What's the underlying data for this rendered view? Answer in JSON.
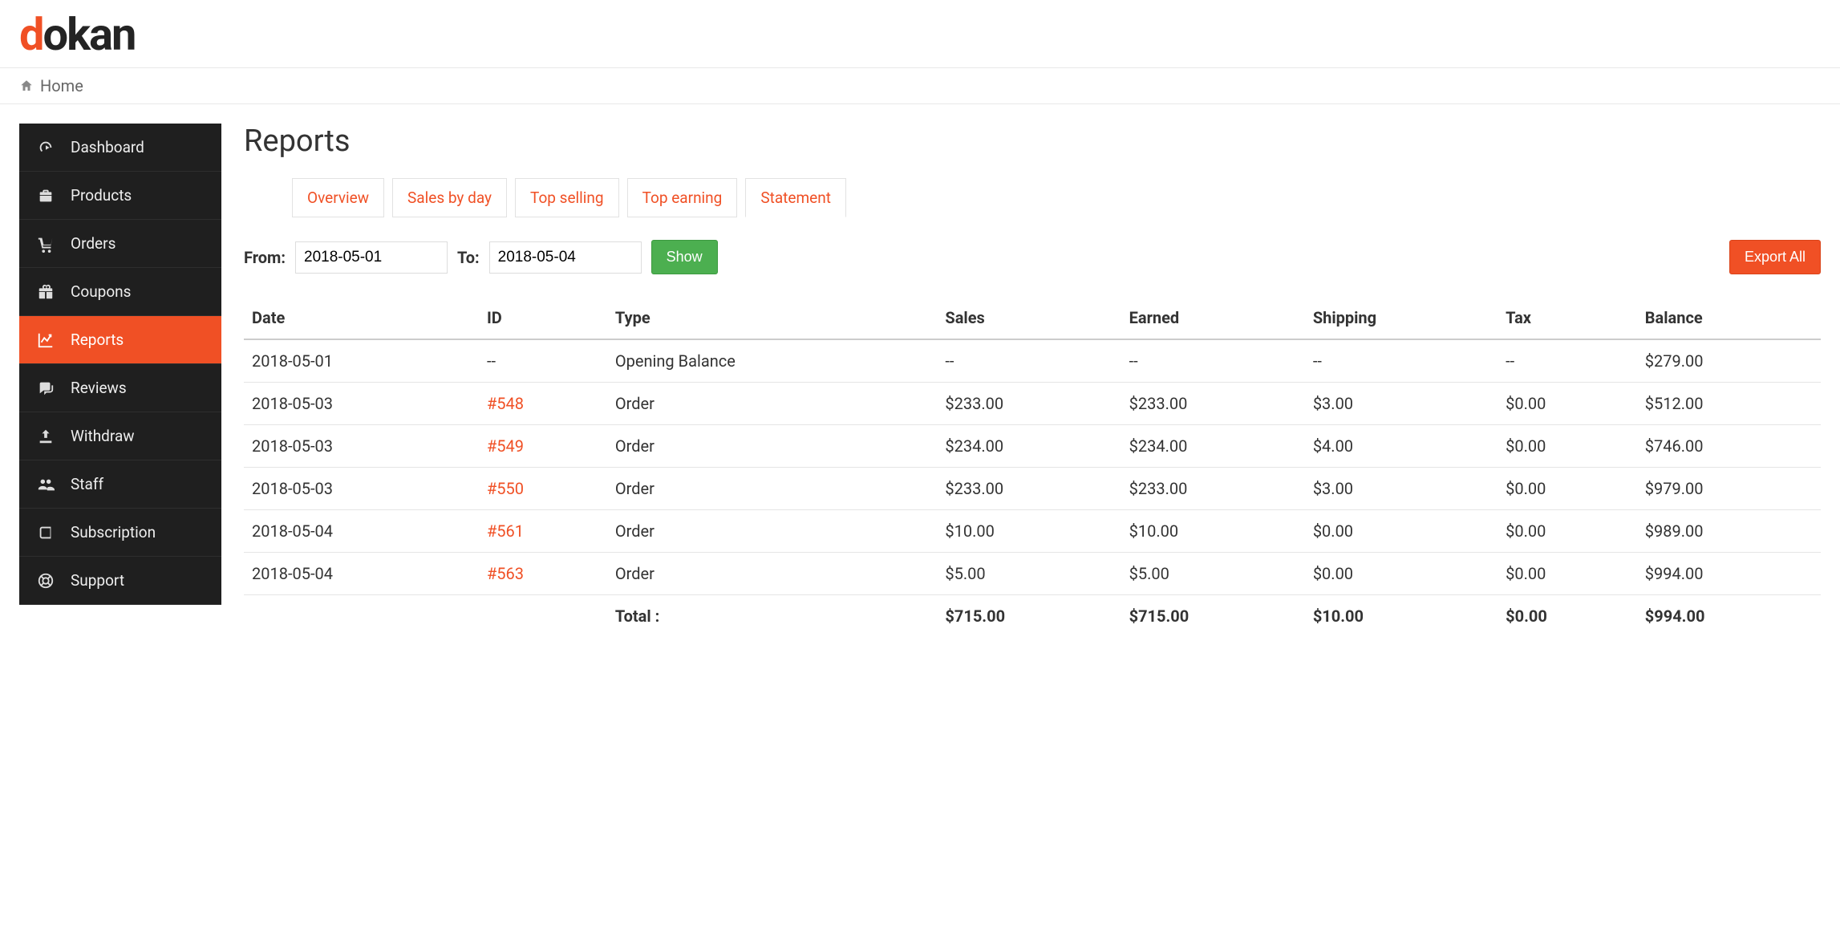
{
  "brand": {
    "d": "d",
    "okan": "okan"
  },
  "breadcrumb": {
    "home": "Home"
  },
  "sidebar": {
    "items": [
      {
        "label": "Dashboard",
        "icon": "gauge-icon",
        "active": false
      },
      {
        "label": "Products",
        "icon": "briefcase-icon",
        "active": false
      },
      {
        "label": "Orders",
        "icon": "cart-icon",
        "active": false
      },
      {
        "label": "Coupons",
        "icon": "gift-icon",
        "active": false
      },
      {
        "label": "Reports",
        "icon": "chart-line-icon",
        "active": true
      },
      {
        "label": "Reviews",
        "icon": "comments-icon",
        "active": false
      },
      {
        "label": "Withdraw",
        "icon": "upload-icon",
        "active": false
      },
      {
        "label": "Staff",
        "icon": "users-icon",
        "active": false
      },
      {
        "label": "Subscription",
        "icon": "book-icon",
        "active": false
      },
      {
        "label": "Support",
        "icon": "life-ring-icon",
        "active": false
      }
    ]
  },
  "page": {
    "title": "Reports"
  },
  "tabs": [
    {
      "label": "Overview",
      "active": false
    },
    {
      "label": "Sales by day",
      "active": false
    },
    {
      "label": "Top selling",
      "active": false
    },
    {
      "label": "Top earning",
      "active": false
    },
    {
      "label": "Statement",
      "active": true
    }
  ],
  "filter": {
    "from_label": "From:",
    "from_value": "2018-05-01",
    "to_label": "To:",
    "to_value": "2018-05-04",
    "show_label": "Show",
    "export_label": "Export All"
  },
  "table": {
    "headers": {
      "date": "Date",
      "id": "ID",
      "type": "Type",
      "sales": "Sales",
      "earned": "Earned",
      "shipping": "Shipping",
      "tax": "Tax",
      "balance": "Balance"
    },
    "rows": [
      {
        "date": "2018-05-01",
        "id": "--",
        "id_link": false,
        "type": "Opening Balance",
        "sales": "--",
        "earned": "--",
        "shipping": "--",
        "tax": "--",
        "balance": "$279.00"
      },
      {
        "date": "2018-05-03",
        "id": "#548",
        "id_link": true,
        "type": "Order",
        "sales": "$233.00",
        "earned": "$233.00",
        "shipping": "$3.00",
        "tax": "$0.00",
        "balance": "$512.00"
      },
      {
        "date": "2018-05-03",
        "id": "#549",
        "id_link": true,
        "type": "Order",
        "sales": "$234.00",
        "earned": "$234.00",
        "shipping": "$4.00",
        "tax": "$0.00",
        "balance": "$746.00"
      },
      {
        "date": "2018-05-03",
        "id": "#550",
        "id_link": true,
        "type": "Order",
        "sales": "$233.00",
        "earned": "$233.00",
        "shipping": "$3.00",
        "tax": "$0.00",
        "balance": "$979.00"
      },
      {
        "date": "2018-05-04",
        "id": "#561",
        "id_link": true,
        "type": "Order",
        "sales": "$10.00",
        "earned": "$10.00",
        "shipping": "$0.00",
        "tax": "$0.00",
        "balance": "$989.00"
      },
      {
        "date": "2018-05-04",
        "id": "#563",
        "id_link": true,
        "type": "Order",
        "sales": "$5.00",
        "earned": "$5.00",
        "shipping": "$0.00",
        "tax": "$0.00",
        "balance": "$994.00"
      }
    ],
    "total": {
      "label": "Total :",
      "sales": "$715.00",
      "earned": "$715.00",
      "shipping": "$10.00",
      "tax": "$0.00",
      "balance": "$994.00"
    }
  }
}
